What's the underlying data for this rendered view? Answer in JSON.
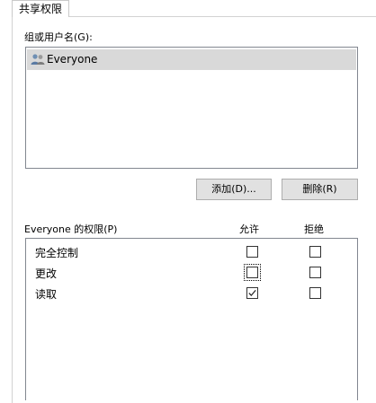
{
  "tabs": [
    {
      "label": "共享权限"
    }
  ],
  "group": {
    "label": "组或用户名(G):",
    "items": [
      {
        "name": "Everyone",
        "icon": "users-icon"
      }
    ]
  },
  "buttons": {
    "add": "添加(D)...",
    "remove": "删除(R)"
  },
  "permissions": {
    "label": "Everyone 的权限(P)",
    "allow_header": "允许",
    "deny_header": "拒绝",
    "rows": [
      {
        "name": "完全控制",
        "allow": false,
        "deny": false
      },
      {
        "name": "更改",
        "allow": false,
        "deny": false
      },
      {
        "name": "读取",
        "allow": true,
        "deny": false
      }
    ]
  }
}
